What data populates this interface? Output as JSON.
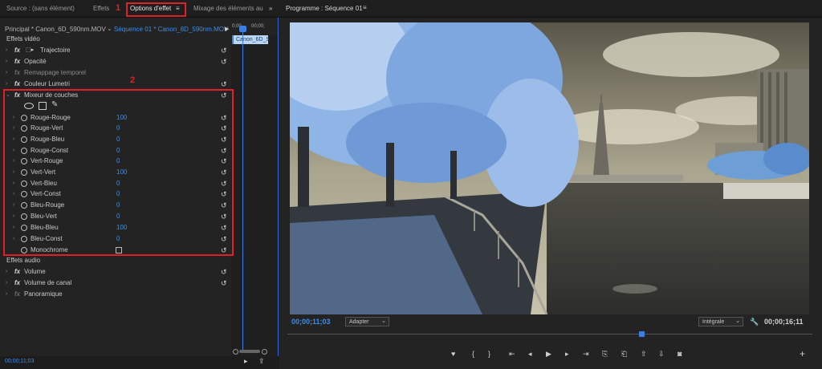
{
  "left_panel": {
    "tabs": [
      {
        "label": "Source : (sans élément)"
      },
      {
        "label": "Effets"
      },
      {
        "label": "Options d'effet"
      },
      {
        "label": "Mixage des éléments au"
      }
    ],
    "annotation_1": "1",
    "annotation_2": "2",
    "header": {
      "source_clip": "Principal * Canon_6D_590nm.MOV",
      "sequence_clip": "Séquence 01 * Canon_6D_590nm.MOV",
      "timecode_a": "0;00",
      "timecode_b": "00;00;",
      "clip_label": "Canon_6D_S"
    },
    "sections": {
      "video": "Effets vidéo",
      "audio": "Effets audio"
    },
    "video_effects": [
      {
        "label": "Trajectoire"
      },
      {
        "label": "Opacité"
      },
      {
        "label": "Remappage temporel"
      },
      {
        "label": "Couleur Lumetri"
      },
      {
        "label": "Mixeur de couches"
      }
    ],
    "mixer_params": [
      {
        "label": "Rouge-Rouge",
        "value": "100"
      },
      {
        "label": "Rouge-Vert",
        "value": "0"
      },
      {
        "label": "Rouge-Bleu",
        "value": "0"
      },
      {
        "label": "Rouge-Const",
        "value": "0"
      },
      {
        "label": "Vert-Rouge",
        "value": "0"
      },
      {
        "label": "Vert-Vert",
        "value": "100"
      },
      {
        "label": "Vert-Bleu",
        "value": "0"
      },
      {
        "label": "Vert-Const",
        "value": "0"
      },
      {
        "label": "Bleu-Rouge",
        "value": "0"
      },
      {
        "label": "Bleu-Vert",
        "value": "0"
      },
      {
        "label": "Bleu-Bleu",
        "value": "100"
      },
      {
        "label": "Bleu-Const",
        "value": "0"
      },
      {
        "label": "Monochrome",
        "value": ""
      }
    ],
    "audio_effects": [
      {
        "label": "Volume"
      },
      {
        "label": "Volume de canal"
      },
      {
        "label": "Panoramique"
      }
    ],
    "bottom_timecode": "00;00;11;03"
  },
  "program_panel": {
    "title": "Programme : Séquence 01",
    "current_timecode": "00;00;11;03",
    "zoom": "Adapter",
    "quality": "Intégrale",
    "duration_timecode": "00;00;16;11"
  },
  "colors": {
    "accent_blue": "#3d8eea",
    "annotation_red": "#e0202a",
    "panel_bg": "#232323"
  }
}
